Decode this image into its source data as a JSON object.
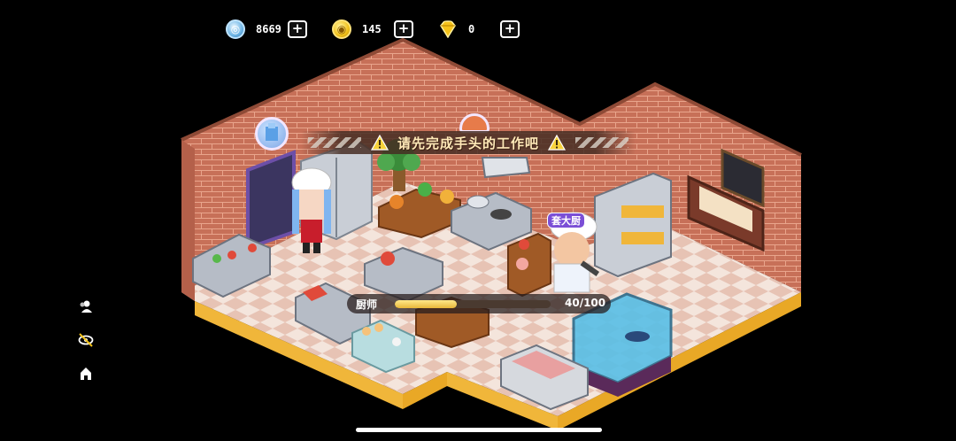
{
  "hud": {
    "silver": {
      "value": "8669",
      "icon": "silver-coin-icon"
    },
    "gold": {
      "value": "145",
      "icon": "gold-coin-icon"
    },
    "gem": {
      "value": "0",
      "icon": "diamond-icon"
    },
    "plus_symbol": "+"
  },
  "banner": {
    "message": "请先完成手头的工作吧",
    "icon": "warning-icon"
  },
  "progress": {
    "label": "厨师",
    "current": 40,
    "max": 100,
    "text": "40/100"
  },
  "npc": {
    "name": "套大厨"
  },
  "side_buttons": [
    {
      "icon": "friends-icon"
    },
    {
      "icon": "hide-eye-icon"
    },
    {
      "icon": "decorate-icon"
    }
  ],
  "colors": {
    "brick": "#c9745a",
    "floor_light": "#f3e2d8",
    "floor_dark": "#e2b9a8",
    "accent_gold": "#f2c21a"
  }
}
